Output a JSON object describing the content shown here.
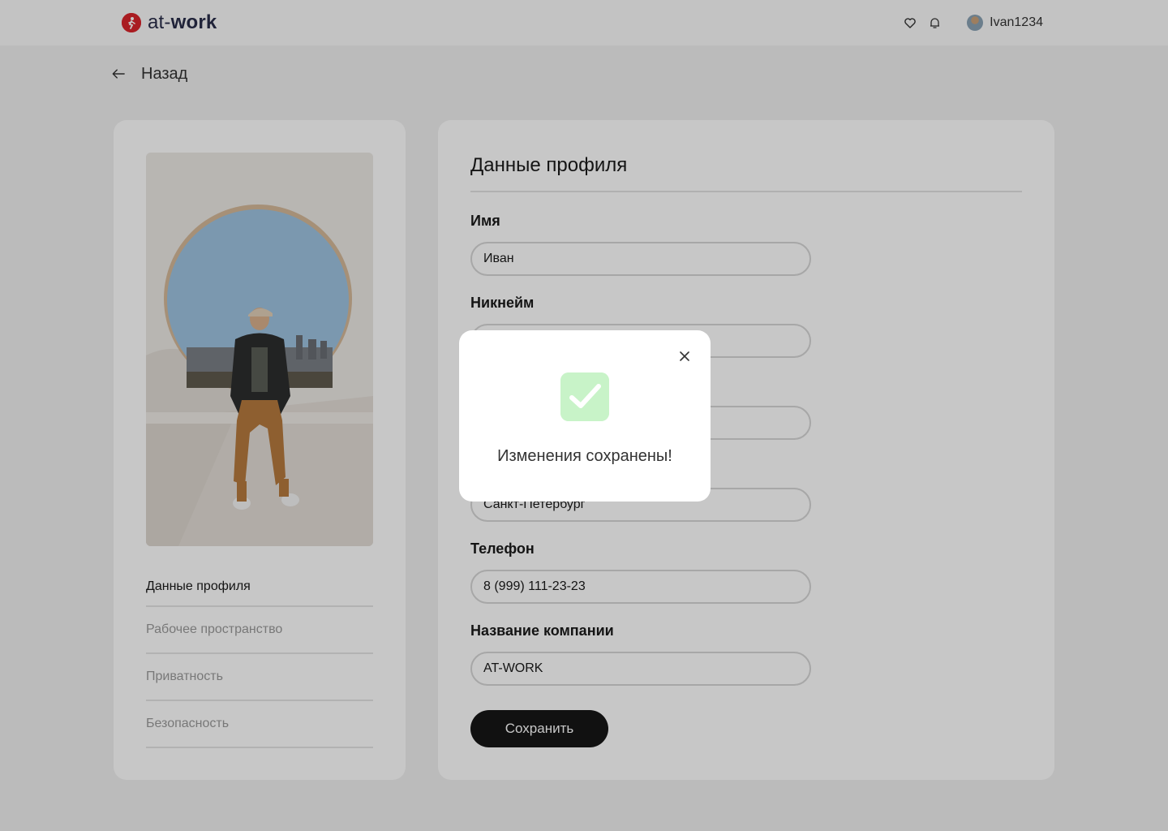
{
  "header": {
    "logo_prefix": "at-",
    "logo_bold": "work",
    "username": "Ivan1234",
    "icons": [
      "heart-icon",
      "bell-icon",
      "avatar"
    ]
  },
  "back": {
    "label": "Назад"
  },
  "sidebar": {
    "items": [
      {
        "label": "Данные профиля",
        "active": true
      },
      {
        "label": "Рабочее пространство",
        "active": false
      },
      {
        "label": "Приватность",
        "active": false
      },
      {
        "label": "Безопасность",
        "active": false
      }
    ]
  },
  "profile": {
    "title": "Данные профиля",
    "fields": [
      {
        "label": "Имя",
        "value": "Иван"
      },
      {
        "label": "Никнейм",
        "value": ""
      },
      {
        "label": "",
        "value": ""
      },
      {
        "label": "",
        "value": "Санкт-Петербург"
      },
      {
        "label": "Телефон",
        "value": "8 (999) 111-23-23"
      },
      {
        "label": "Название компании",
        "value": "AT-WORK"
      }
    ],
    "save_label": "Сохранить"
  },
  "modal": {
    "message": "Изменения сохранены!"
  },
  "colors": {
    "accent_dark": "#161616",
    "success": "#c8f3c8",
    "success_check": "#3fbf4f",
    "logo_red": "#d9252b"
  }
}
